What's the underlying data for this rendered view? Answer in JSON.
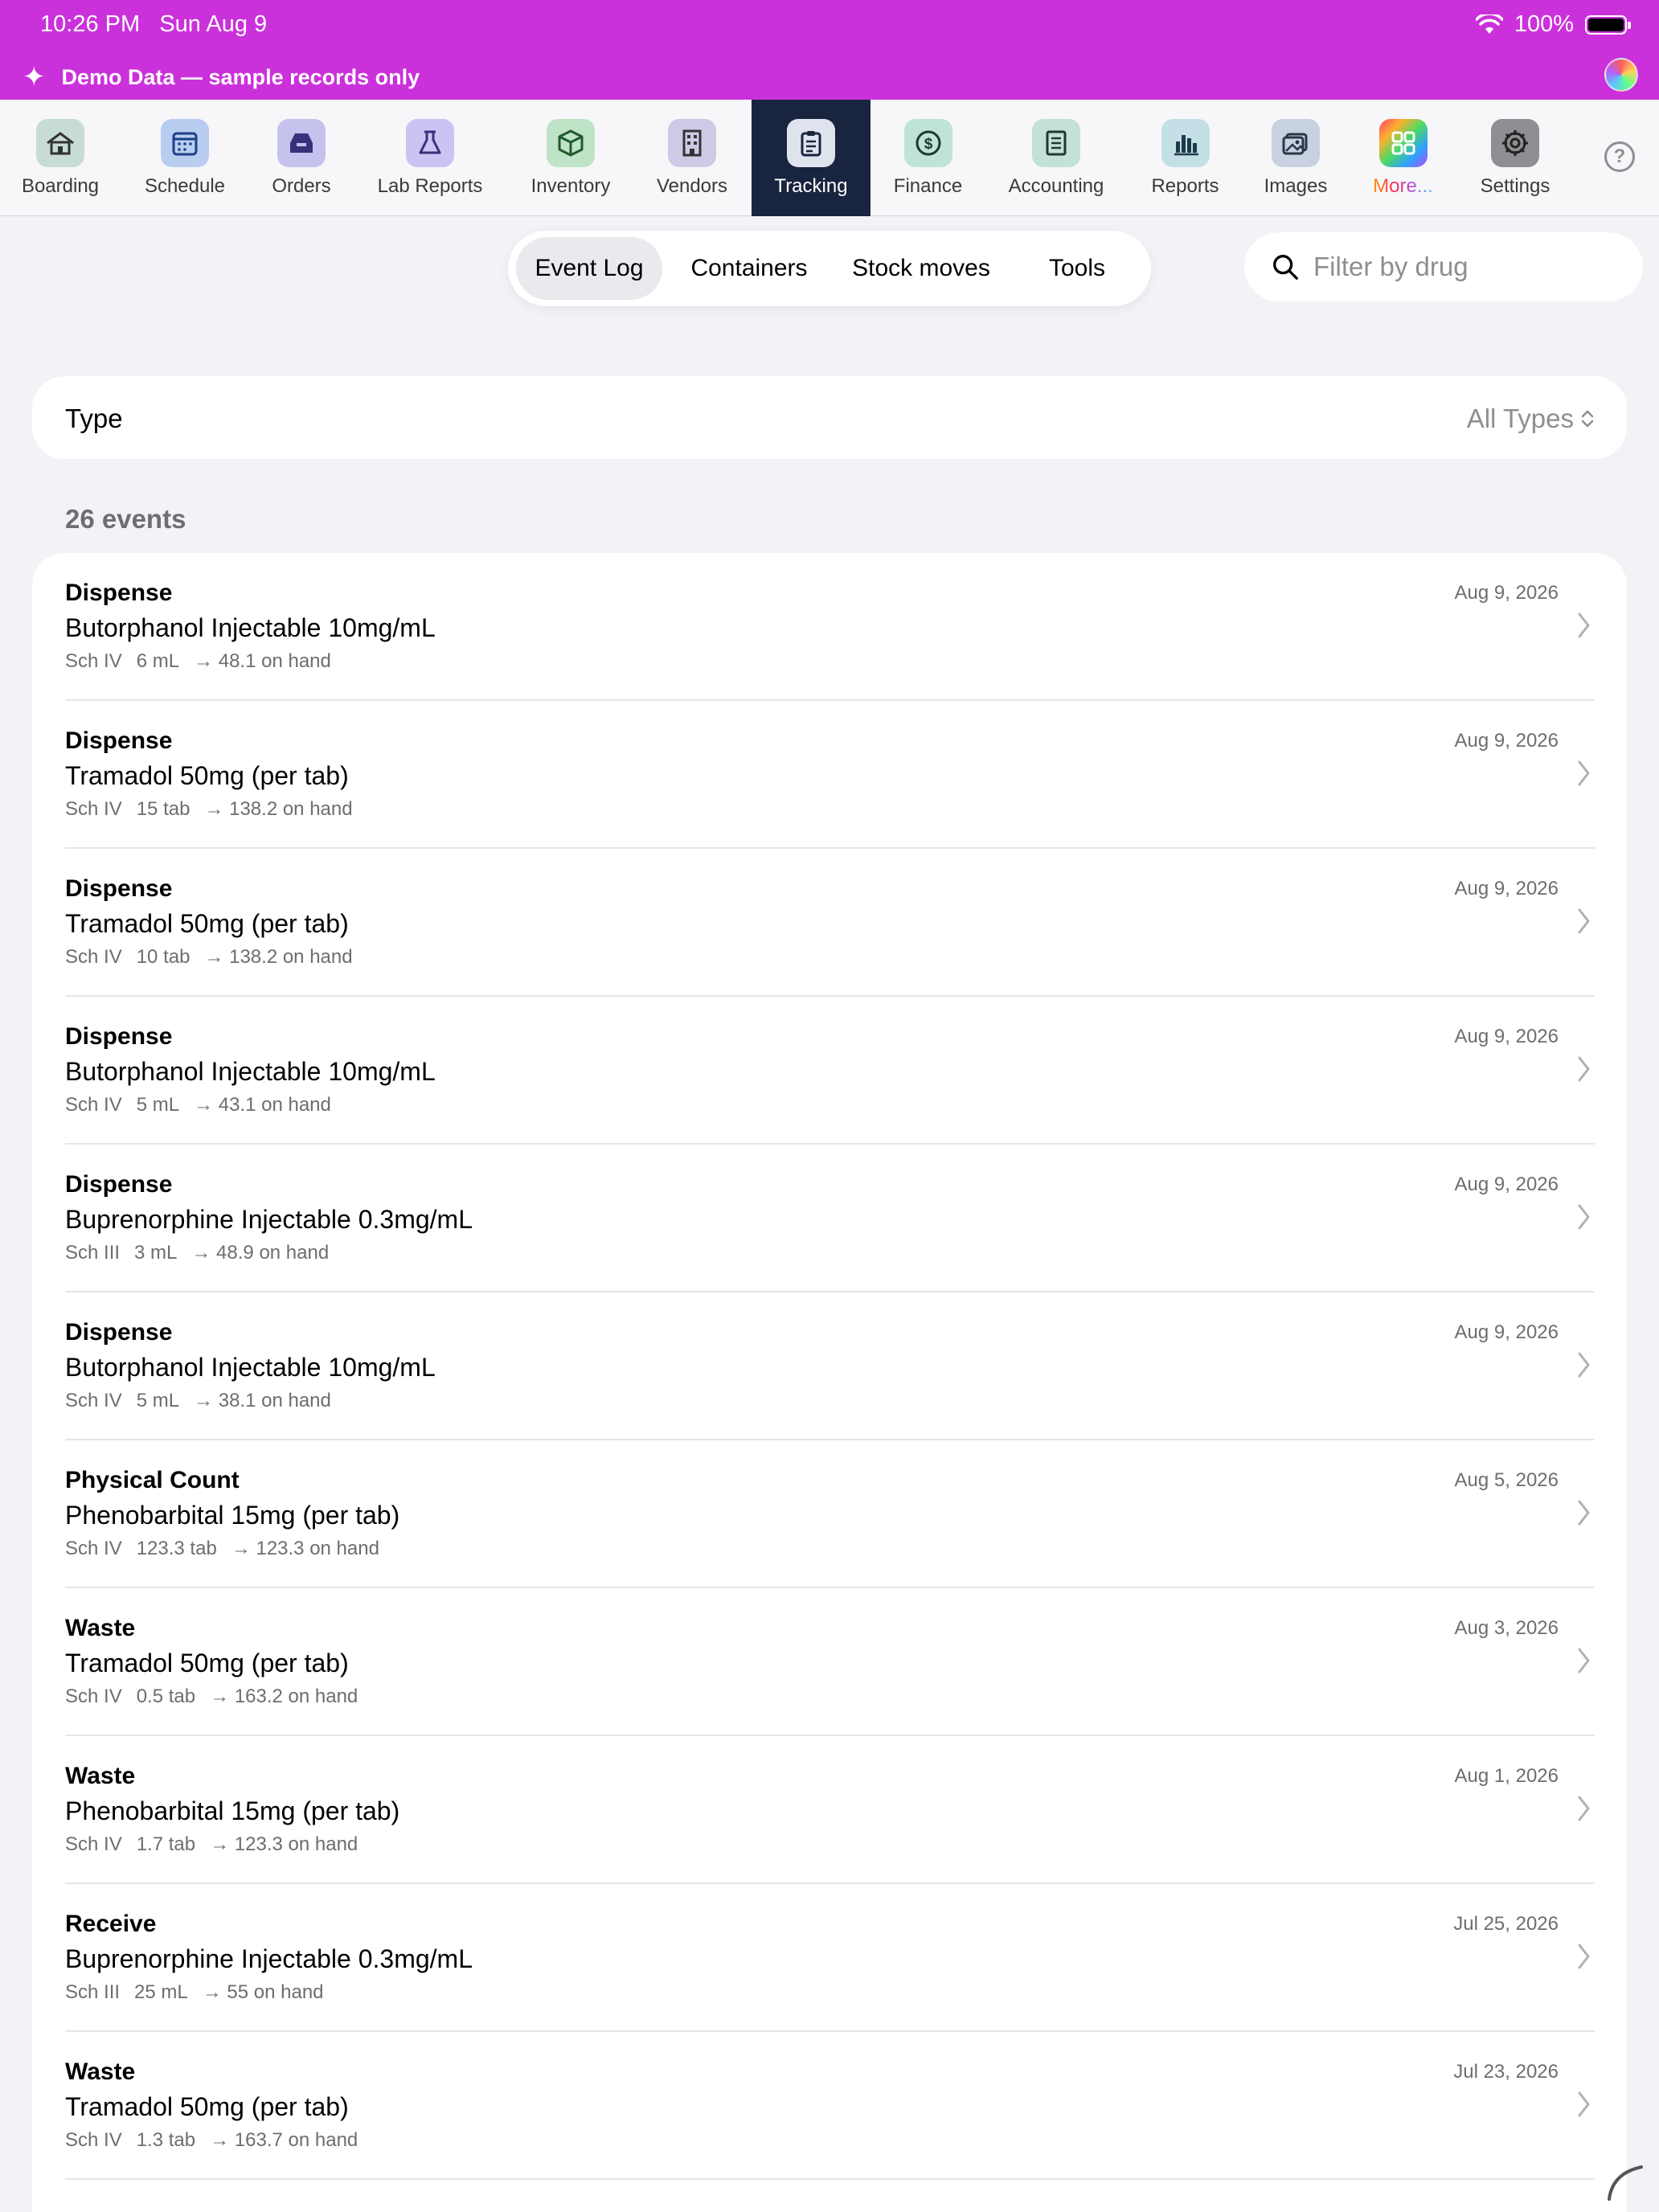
{
  "status": {
    "time": "10:26 PM",
    "date": "Sun Aug 9",
    "battery": "100%"
  },
  "banner": {
    "text": "Demo Data — sample records only"
  },
  "tabs": [
    {
      "label": "Boarding",
      "icon": "house-icon",
      "color": "#c8dcd6"
    },
    {
      "label": "Schedule",
      "icon": "calendar-icon",
      "color": "#b8cdf0"
    },
    {
      "label": "Orders",
      "icon": "tray-icon",
      "color": "#c6c2ee"
    },
    {
      "label": "Lab Reports",
      "icon": "flask-icon",
      "color": "#cbc3f2"
    },
    {
      "label": "Inventory",
      "icon": "box-icon",
      "color": "#bfe3c6"
    },
    {
      "label": "Vendors",
      "icon": "building-icon",
      "color": "#cfc9e6"
    },
    {
      "label": "Tracking",
      "icon": "clipboard-icon",
      "color": "#dfe3ee"
    },
    {
      "label": "Finance",
      "icon": "dollar-icon",
      "color": "#bfe3d8"
    },
    {
      "label": "Accounting",
      "icon": "ledger-icon",
      "color": "#c3e1d8"
    },
    {
      "label": "Reports",
      "icon": "bar-chart-icon",
      "color": "#c4e0e6"
    },
    {
      "label": "Images",
      "icon": "photos-icon",
      "color": "#c8d1e0"
    },
    {
      "label": "More...",
      "icon": "grid-icon",
      "color": "#ff6aa0"
    },
    {
      "label": "Settings",
      "icon": "gear-icon",
      "color": "#8e8e93"
    }
  ],
  "segments": [
    "Event Log",
    "Containers",
    "Stock moves",
    "Tools"
  ],
  "search": {
    "placeholder": "Filter by drug"
  },
  "filter": {
    "label": "Type",
    "value": "All Types"
  },
  "count": "26 events",
  "events": [
    {
      "type": "Dispense",
      "drug": "Butorphanol Injectable 10mg/mL",
      "schedule": "Sch IV",
      "qty": "6 mL",
      "onhand": "→ 48.1 on hand",
      "date": "Aug 9, 2026"
    },
    {
      "type": "Dispense",
      "drug": "Tramadol 50mg (per tab)",
      "schedule": "Sch IV",
      "qty": "15 tab",
      "onhand": "→ 138.2 on hand",
      "date": "Aug 9, 2026"
    },
    {
      "type": "Dispense",
      "drug": "Tramadol 50mg (per tab)",
      "schedule": "Sch IV",
      "qty": "10 tab",
      "onhand": "→ 138.2 on hand",
      "date": "Aug 9, 2026"
    },
    {
      "type": "Dispense",
      "drug": "Butorphanol Injectable 10mg/mL",
      "schedule": "Sch IV",
      "qty": "5 mL",
      "onhand": "→ 43.1 on hand",
      "date": "Aug 9, 2026"
    },
    {
      "type": "Dispense",
      "drug": "Buprenorphine Injectable 0.3mg/mL",
      "schedule": "Sch III",
      "qty": "3 mL",
      "onhand": "→ 48.9 on hand",
      "date": "Aug 9, 2026"
    },
    {
      "type": "Dispense",
      "drug": "Butorphanol Injectable 10mg/mL",
      "schedule": "Sch IV",
      "qty": "5 mL",
      "onhand": "→ 38.1 on hand",
      "date": "Aug 9, 2026"
    },
    {
      "type": "Physical Count",
      "drug": "Phenobarbital 15mg (per tab)",
      "schedule": "Sch IV",
      "qty": "123.3 tab",
      "onhand": "→ 123.3 on hand",
      "date": "Aug 5, 2026"
    },
    {
      "type": "Waste",
      "drug": "Tramadol 50mg (per tab)",
      "schedule": "Sch IV",
      "qty": "0.5 tab",
      "onhand": "→ 163.2 on hand",
      "date": "Aug 3, 2026"
    },
    {
      "type": "Waste",
      "drug": "Phenobarbital 15mg (per tab)",
      "schedule": "Sch IV",
      "qty": "1.7 tab",
      "onhand": "→ 123.3 on hand",
      "date": "Aug 1, 2026"
    },
    {
      "type": "Receive",
      "drug": "Buprenorphine Injectable 0.3mg/mL",
      "schedule": "Sch III",
      "qty": "25 mL",
      "onhand": "→ 55 on hand",
      "date": "Jul 25, 2026"
    },
    {
      "type": "Waste",
      "drug": "Tramadol 50mg (per tab)",
      "schedule": "Sch IV",
      "qty": "1.3 tab",
      "onhand": "→ 163.7 on hand",
      "date": "Jul 23, 2026"
    }
  ]
}
